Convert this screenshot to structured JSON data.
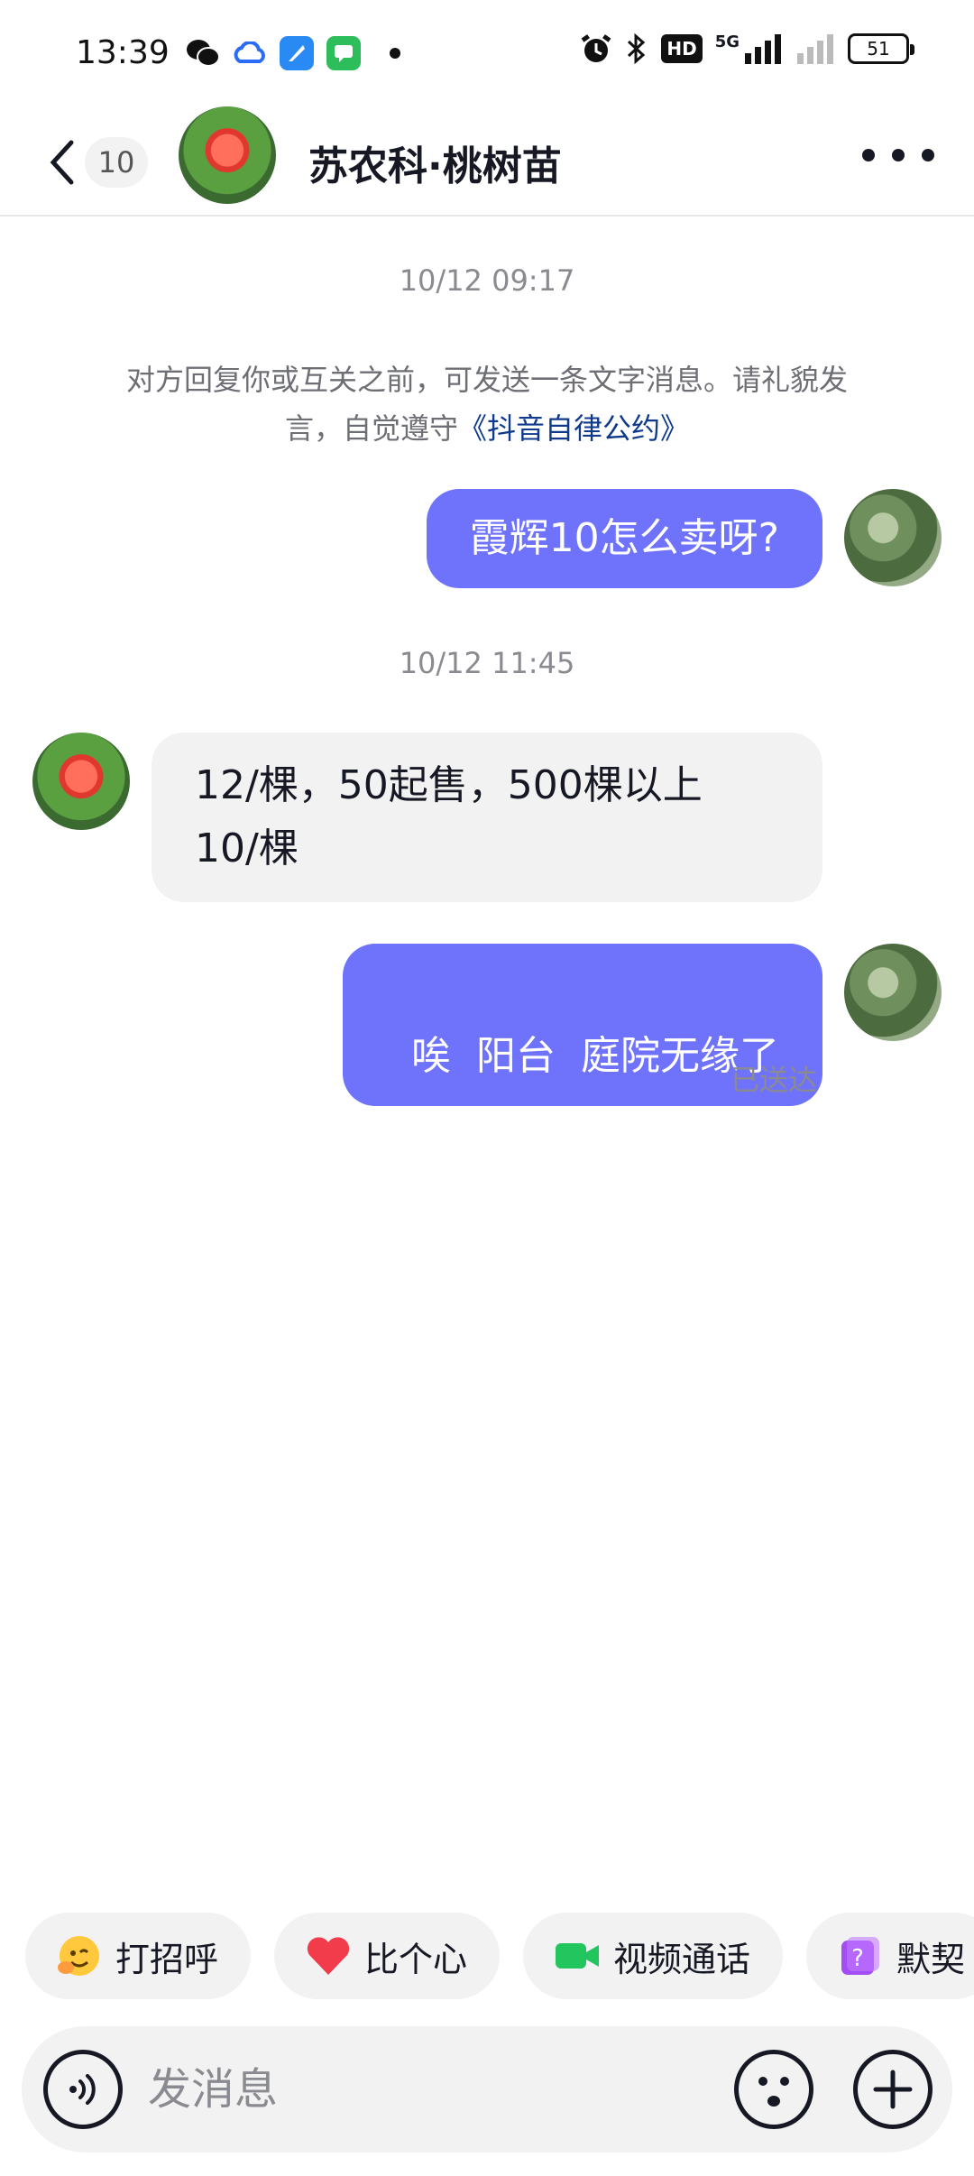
{
  "status_bar": {
    "time": "13:39",
    "network": "5G",
    "hd_badge": "HD",
    "battery": "51",
    "app_icons": [
      "wechat-icon",
      "cloud-icon",
      "feather-icon",
      "message-icon"
    ]
  },
  "header": {
    "unread_count": "10",
    "title": "苏农科·桃树苗"
  },
  "chat": {
    "timestamp_1": "10/12 09:17",
    "notice_text": "对方回复你或互关之前，可发送一条文字消息。请礼貌发言，自觉遵守",
    "notice_link": "《抖音自律公约》",
    "messages": [
      {
        "sender": "me",
        "text": "霞辉10怎么卖呀?"
      },
      {
        "sender": "them",
        "line1": "12/棵，50起售，500棵以上",
        "line2": "10/棵"
      },
      {
        "sender": "me",
        "text": "唉  阳台  庭院无缘了"
      }
    ],
    "timestamp_2": "10/12 11:45",
    "sent_status": "已送达"
  },
  "quick_actions": [
    {
      "label": "打招呼",
      "icon": "wave-emoji-icon"
    },
    {
      "label": "比个心",
      "icon": "heart-icon"
    },
    {
      "label": "视频通话",
      "icon": "video-camera-icon"
    },
    {
      "label": "默契",
      "icon": "question-box-icon"
    }
  ],
  "input": {
    "placeholder": "发消息"
  },
  "colors": {
    "my_bubble": "#6f72fb",
    "their_bubble": "#f2f2f2",
    "link": "#0f3a8c"
  }
}
